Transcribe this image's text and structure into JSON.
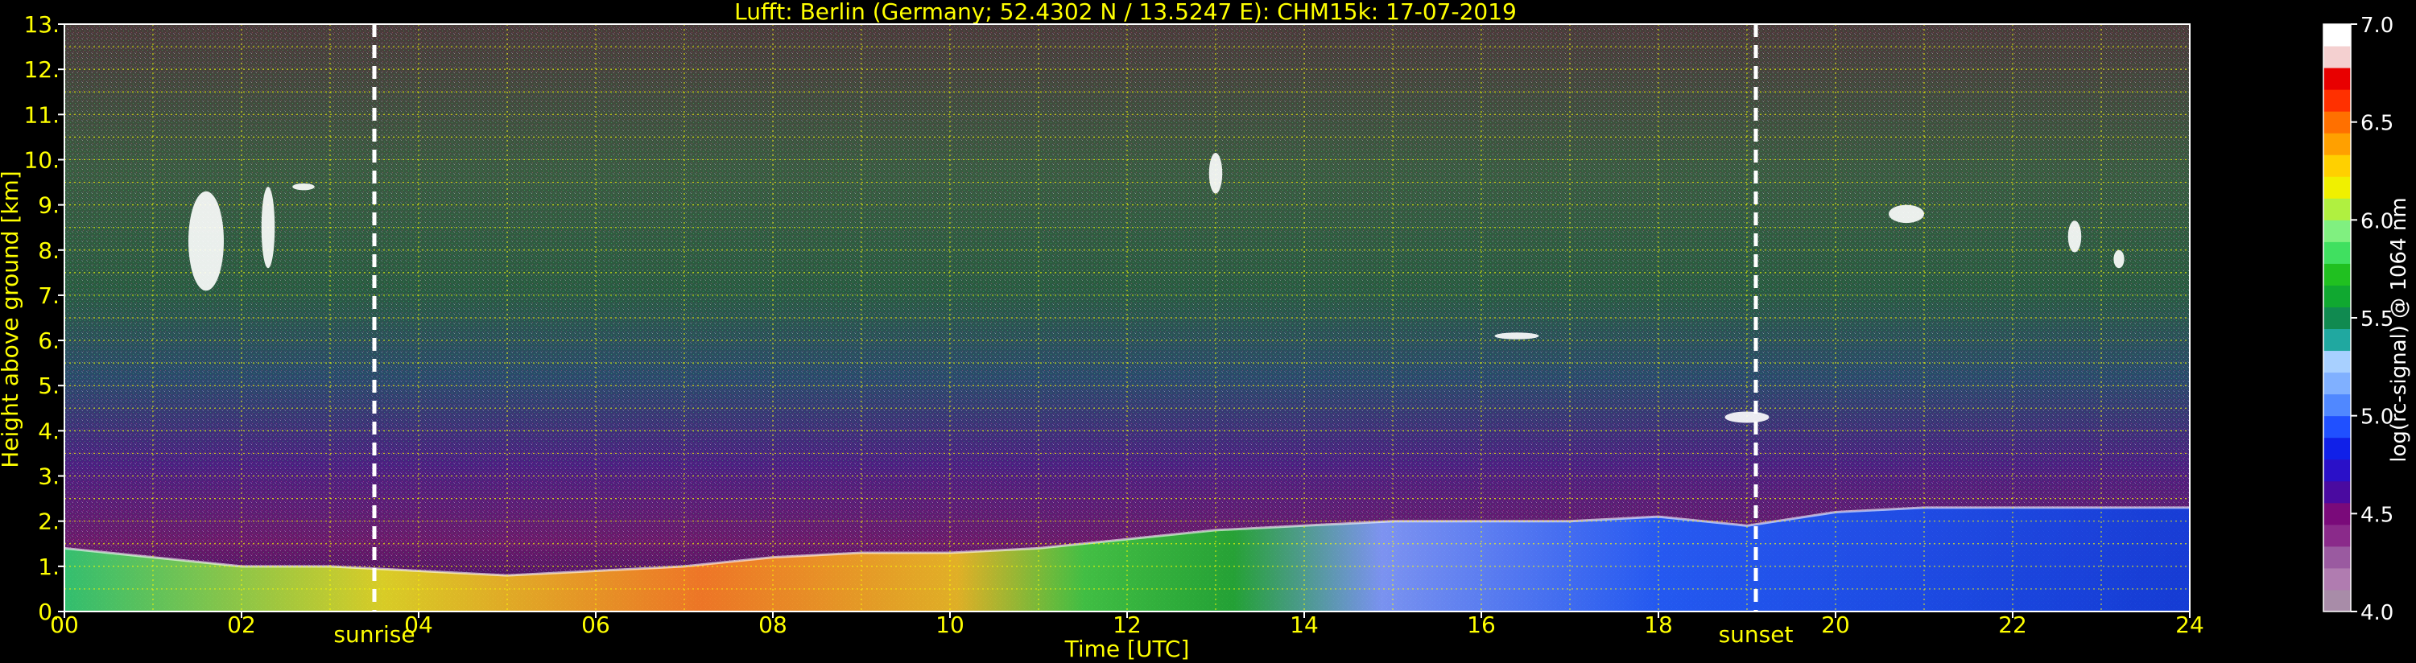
{
  "chart_data": {
    "type": "heatmap",
    "title": "Lufft: Berlin (Germany; 52.4302 N / 13.5247 E):    CHM15k: 17-07-2019",
    "xlabel": "Time [UTC]",
    "ylabel": "Height above ground [km]",
    "xlim": [
      0,
      24
    ],
    "ylim": [
      0,
      13
    ],
    "x_ticks": [
      "00",
      "02",
      "04",
      "06",
      "08",
      "10",
      "12",
      "14",
      "16",
      "18",
      "20",
      "22",
      "24"
    ],
    "y_ticks": [
      "0.",
      "1.",
      "2.",
      "3.",
      "4.",
      "5.",
      "6.",
      "7.",
      "8.",
      "9.",
      "10.",
      "11.",
      "12.",
      "13."
    ],
    "grid": true,
    "grid_x_step": 1,
    "grid_y_step": 0.5,
    "events": [
      {
        "label": "sunrise",
        "x": 3.5
      },
      {
        "label": "sunset",
        "x": 19.1
      }
    ],
    "colorbar": {
      "label": "log(rc-signal) @ 1064 nm",
      "range": [
        4.0,
        7.0
      ],
      "ticks": [
        "4.0",
        "4.5",
        "5.0",
        "5.5",
        "6.0",
        "6.5",
        "7.0"
      ],
      "colors": [
        "#a88ca8",
        "#b07cb0",
        "#9a5aa0",
        "#8a2a8a",
        "#7a0a7a",
        "#4a0aa0",
        "#2a10c8",
        "#1020e8",
        "#2050ff",
        "#5088ff",
        "#80b0ff",
        "#a8d0ff",
        "#20a8a0",
        "#108a50",
        "#10a830",
        "#20c020",
        "#40e060",
        "#80f080",
        "#b0f040",
        "#f0f000",
        "#ffd000",
        "#ffa000",
        "#ff7000",
        "#ff3000",
        "#e80000",
        "#f4d0d0",
        "#ffffff"
      ]
    },
    "boundary_layer_height_km": [
      {
        "x": 0,
        "y": 1.4
      },
      {
        "x": 1,
        "y": 1.2
      },
      {
        "x": 2,
        "y": 1.0
      },
      {
        "x": 3,
        "y": 1.0
      },
      {
        "x": 4,
        "y": 0.9
      },
      {
        "x": 5,
        "y": 0.8
      },
      {
        "x": 6,
        "y": 0.9
      },
      {
        "x": 7,
        "y": 1.0
      },
      {
        "x": 8,
        "y": 1.2
      },
      {
        "x": 9,
        "y": 1.3
      },
      {
        "x": 10,
        "y": 1.3
      },
      {
        "x": 11,
        "y": 1.4
      },
      {
        "x": 12,
        "y": 1.6
      },
      {
        "x": 13,
        "y": 1.8
      },
      {
        "x": 14,
        "y": 1.9
      },
      {
        "x": 15,
        "y": 2.0
      },
      {
        "x": 16,
        "y": 2.0
      },
      {
        "x": 17,
        "y": 2.0
      },
      {
        "x": 18,
        "y": 2.1
      },
      {
        "x": 19,
        "y": 1.9
      },
      {
        "x": 20,
        "y": 2.2
      },
      {
        "x": 21,
        "y": 2.3
      },
      {
        "x": 22,
        "y": 2.3
      },
      {
        "x": 23,
        "y": 2.3
      },
      {
        "x": 24,
        "y": 2.3
      }
    ],
    "cloud_features": [
      {
        "x": 1.6,
        "y": 8.2,
        "w": 0.4,
        "h": 2.2
      },
      {
        "x": 2.3,
        "y": 8.5,
        "w": 0.15,
        "h": 1.8
      },
      {
        "x": 2.7,
        "y": 9.4,
        "w": 0.25,
        "h": 0.15
      },
      {
        "x": 13.0,
        "y": 9.7,
        "w": 0.15,
        "h": 0.9
      },
      {
        "x": 19.0,
        "y": 4.3,
        "w": 0.5,
        "h": 0.25
      },
      {
        "x": 16.4,
        "y": 6.1,
        "w": 0.5,
        "h": 0.15
      },
      {
        "x": 20.8,
        "y": 8.8,
        "w": 0.4,
        "h": 0.4
      },
      {
        "x": 22.7,
        "y": 8.3,
        "w": 0.15,
        "h": 0.7
      },
      {
        "x": 23.2,
        "y": 7.8,
        "w": 0.12,
        "h": 0.4
      }
    ]
  }
}
